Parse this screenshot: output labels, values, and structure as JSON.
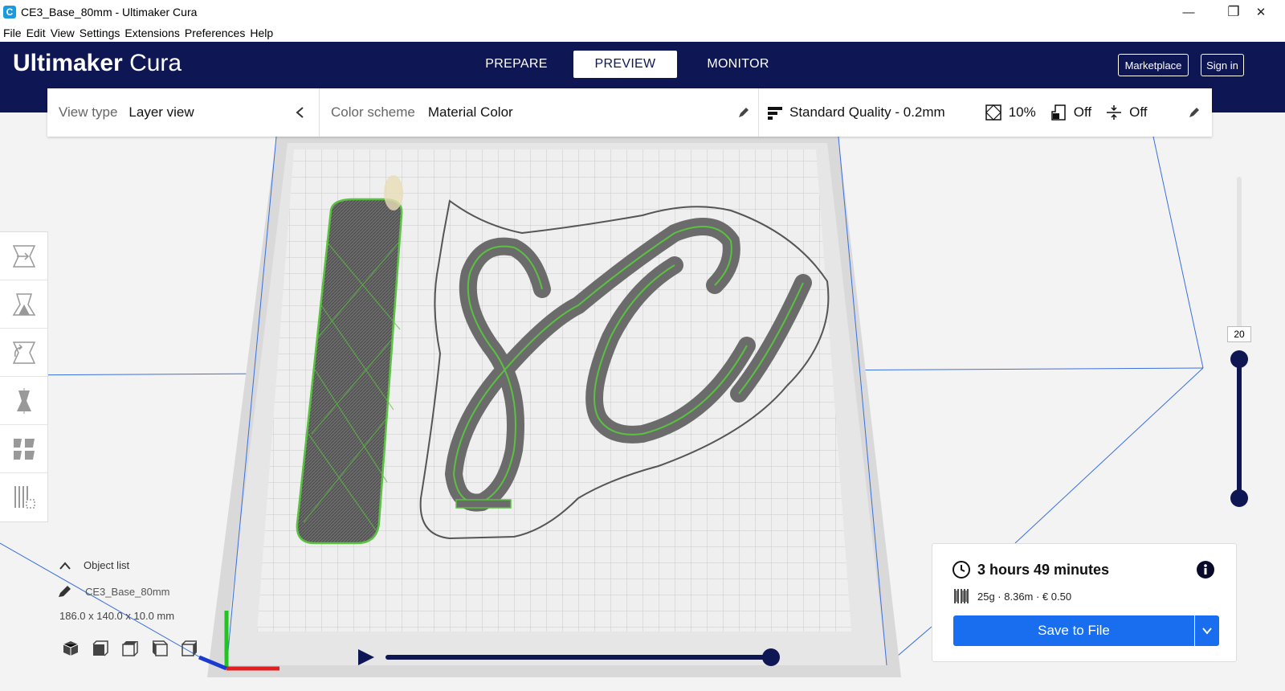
{
  "window": {
    "title": "CE3_Base_80mm - Ultimaker Cura",
    "app_icon_letter": "C",
    "minimize": "—",
    "maximize": "❐",
    "close": "✕"
  },
  "menu": [
    "File",
    "Edit",
    "View",
    "Settings",
    "Extensions",
    "Preferences",
    "Help"
  ],
  "header": {
    "brand_bold": "Ultimaker",
    "brand_light": "Cura",
    "tabs": [
      {
        "label": "PREPARE",
        "active": false
      },
      {
        "label": "PREVIEW",
        "active": true
      },
      {
        "label": "MONITOR",
        "active": false
      }
    ],
    "marketplace": "Marketplace",
    "signin": "Sign in",
    "color": "#0f1654"
  },
  "settings_bar": {
    "view_type_label": "View type",
    "view_type_value": "Layer view",
    "color_scheme_label": "Color scheme",
    "color_scheme_value": "Material Color",
    "quality": "Standard Quality - 0.2mm",
    "infill": "10%",
    "support": "Off",
    "adhesion": "Off"
  },
  "object_list": {
    "header": "Object list",
    "object_name": "CE3_Base_80mm",
    "dimensions": "186.0 x 140.0 x 10.0 mm"
  },
  "layer_slider": {
    "current_layer": "20"
  },
  "print_info": {
    "time": "3 hours 49 minutes",
    "details": "25g · 8.36m · € 0.50",
    "save_label": "Save to File",
    "accent": "#196ef0"
  },
  "playback": {
    "progress_fraction": 1.0
  }
}
